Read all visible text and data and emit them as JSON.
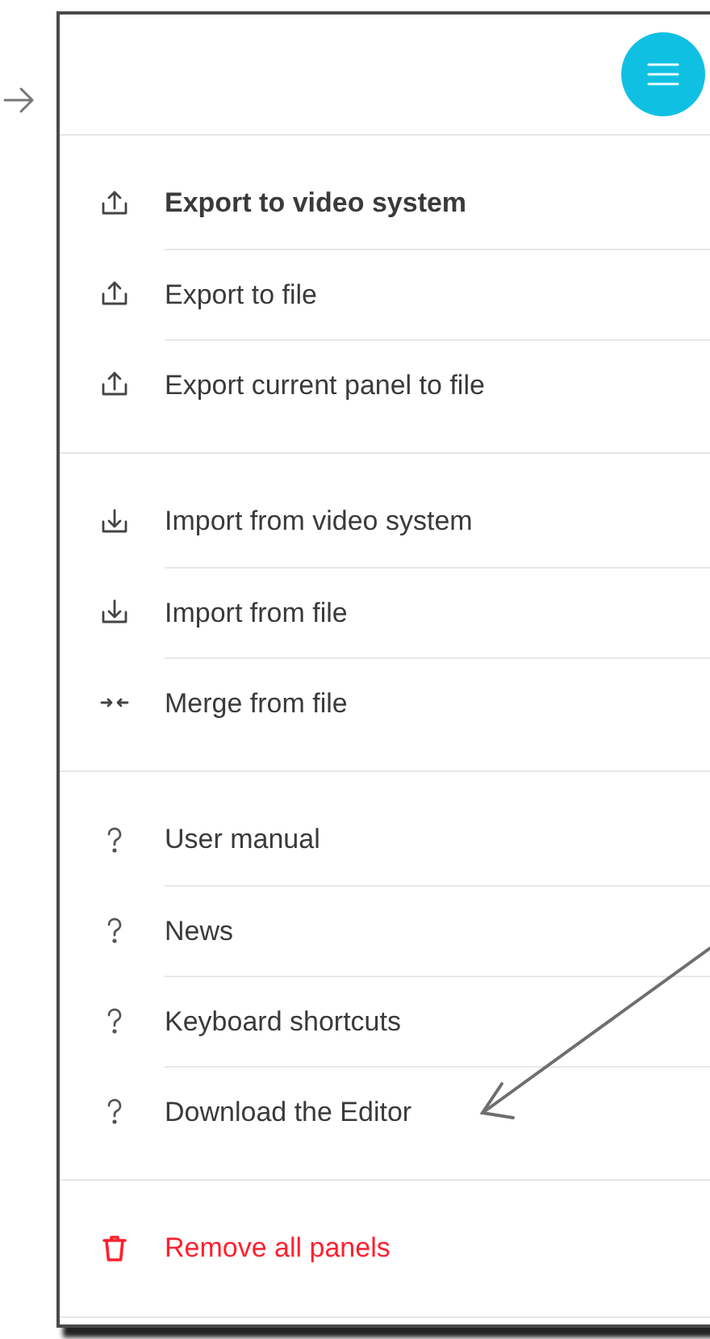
{
  "sections": [
    {
      "items": [
        {
          "label": "Export to video system",
          "kind": "export",
          "bold": true
        },
        {
          "label": "Export to file",
          "kind": "export",
          "bold": false
        },
        {
          "label": "Export current panel to file",
          "kind": "export",
          "bold": false
        }
      ]
    },
    {
      "items": [
        {
          "label": "Import from video system",
          "kind": "import",
          "bold": false
        },
        {
          "label": "Import from file",
          "kind": "import",
          "bold": false
        },
        {
          "label": "Merge from file",
          "kind": "merge",
          "bold": false
        }
      ]
    },
    {
      "items": [
        {
          "label": "User manual",
          "kind": "help",
          "bold": false
        },
        {
          "label": "News",
          "kind": "help",
          "bold": false
        },
        {
          "label": "Keyboard shortcuts",
          "kind": "help",
          "bold": false
        },
        {
          "label": "Download the Editor",
          "kind": "help",
          "bold": false
        }
      ]
    },
    {
      "items": [
        {
          "label": "Remove all panels",
          "kind": "delete",
          "bold": false
        }
      ]
    }
  ]
}
